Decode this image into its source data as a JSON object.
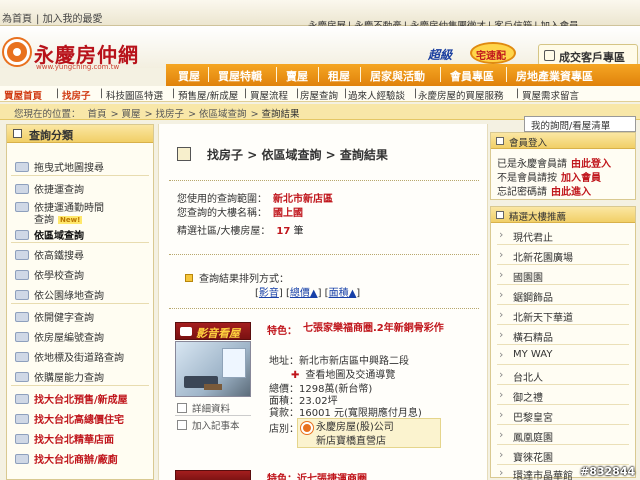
{
  "topbar": {
    "left_links": [
      "為首頁",
      "加入我的最愛"
    ],
    "right_links": [
      "永慶房屋",
      "永慶不動產",
      "永慶房仲集團徵才",
      "客戶信箱",
      "加入會員"
    ]
  },
  "brand": {
    "logo_text": "永慶房仲網",
    "logo_url": "www.yungching.com.tw",
    "slogan": "超級",
    "slogan_badge": "宅速配",
    "deal_button": "成交客戶專區"
  },
  "mainnav": [
    "買屋",
    "買屋特輯",
    "賣屋",
    "租屋",
    "居家與活動",
    "會員專區",
    "房地產業資專區"
  ],
  "subnav": {
    "home": "買屋首頁",
    "items": [
      "找房子",
      "科技圖區特選",
      "預售屋/新成屋",
      "買屋流程",
      "房屋查詢",
      "過來人經驗談",
      "永慶房屋的買屋服務",
      "買屋需求留言"
    ]
  },
  "breadcrumb": {
    "prefix": "您現在的位置：",
    "items": [
      "首頁",
      "買屋",
      "找房子",
      "依區域查詢",
      "查詢結果"
    ]
  },
  "my_query_button": "我的詢問/看屋清單",
  "sidebar": {
    "title": "查詢分類",
    "items": [
      {
        "label": "拖曳式地圖搜尋",
        "style": "normal"
      },
      {
        "label": "依捷運查詢",
        "style": "normal"
      },
      {
        "label": "依捷運通勤時間",
        "style": "normal"
      },
      {
        "label": "查詢",
        "style": "normal",
        "badge": "New!"
      },
      {
        "label": "依區域查詢",
        "style": "bold"
      },
      {
        "label": "依高鐵搜尋",
        "style": "normal"
      },
      {
        "label": "依學校查詢",
        "style": "normal"
      },
      {
        "label": "依公園綠地查詢",
        "style": "normal"
      },
      {
        "label": "依開健字查詢",
        "style": "normal"
      },
      {
        "label": "依房屋編號查詢",
        "style": "normal"
      },
      {
        "label": "依地標及街道路查詢",
        "style": "normal"
      },
      {
        "label": "依購屋能力查詢",
        "style": "normal"
      },
      {
        "label": "找大台北預售/新成屋",
        "style": "red"
      },
      {
        "label": "找大台北高總價住宅",
        "style": "red"
      },
      {
        "label": "找大台北精華店面",
        "style": "red"
      },
      {
        "label": "找大台北商辦/廠廁",
        "style": "red"
      }
    ]
  },
  "content": {
    "title_parts": [
      "找房子",
      "依區域查詢",
      "查詢結果"
    ],
    "scope_label": "您使用的查詢範圍：",
    "scope_value": "新北市新店區",
    "building_label": "您查詢的大樓名稱：",
    "building_value": "國上國",
    "count_label": "精選社區/大樓房屋：",
    "count_value": "17",
    "count_unit": "筆",
    "sort_label": "查詢結果排列方式：",
    "sort_options": [
      "影音",
      "總價▲",
      "面積▲"
    ]
  },
  "listing": {
    "thumb_label": "影音看屋",
    "detail_link": "詳細資料",
    "save_link": "加入記事本",
    "feature_label": "特色：",
    "feature_text": "七張家樂福商圈.2年新銅骨彩作",
    "address_label": "地址：",
    "address": "新北市新店區中興路二段",
    "map_link": "查看地圖及交通導覽",
    "price_label": "總價：",
    "price": "1298萬(新台幣)",
    "area_label": "面積：",
    "area": "23.02坪",
    "loan_label": "貸款：",
    "loan": "16001 元(寬限期應付月息)",
    "store_label": "店別：",
    "agency_name": "永慶房屋(股)公司",
    "agency_branch": "新店寶橋直營店"
  },
  "next_listing": {
    "feature": "特色：近七張捷運商圈"
  },
  "member_panel": {
    "title": "會員登入",
    "lines": [
      {
        "text": "已是永慶會員請",
        "link": "由此登入"
      },
      {
        "text": "不是會員請按",
        "link": "加入會員"
      },
      {
        "text": "忘記密碼請",
        "link": "由此進入"
      }
    ]
  },
  "projects_panel": {
    "title": "精選大樓推薦",
    "items": [
      "現代君止",
      "北新花園廣場",
      "國園園",
      "鋸鋼飾品",
      "北新天下華道",
      "橫石精品",
      "MY WAY",
      "台北人",
      "御之禮",
      "巴黎皇宮",
      "鳳凰庭園",
      "寶徠花園",
      "環達市晶華館"
    ]
  },
  "watermark": "#832844"
}
